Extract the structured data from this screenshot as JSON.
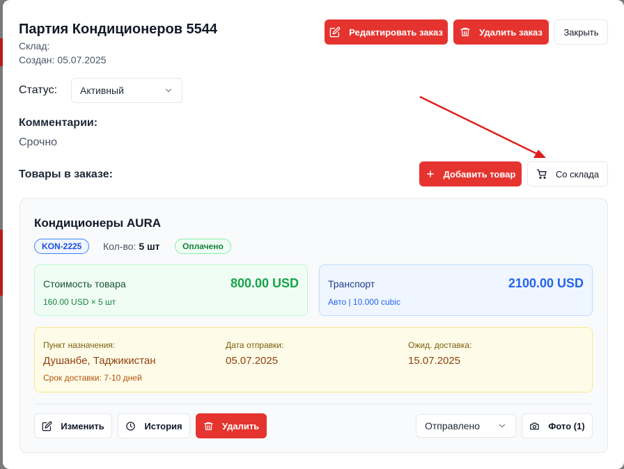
{
  "header": {
    "title": "Партия Кондиционеров 5544",
    "warehouse_line": "Склад:",
    "created_line": "Создан: 05.07.2025"
  },
  "actions": {
    "edit_label": "Редактировать заказ",
    "delete_label": "Удалить заказ",
    "close_label": "Закрыть"
  },
  "status": {
    "label": "Статус:",
    "value": "Активный"
  },
  "comments": {
    "label": "Комментарии:",
    "value": "Срочно"
  },
  "items_section": {
    "label": "Товары в заказе:",
    "add_label": "Добавить товар",
    "from_warehouse_label": "Со склада"
  },
  "item": {
    "name": "Кондиционеры AURA",
    "code": "KON-2225",
    "qty_label": "Кол-во:",
    "qty_value": "5 шт",
    "payment_badge": "Оплачено",
    "cost": {
      "label": "Стоимость товара",
      "amount": "800.00 USD",
      "detail": "160.00 USD × 5 шт"
    },
    "transport": {
      "label": "Транспорт",
      "amount": "2100.00 USD",
      "detail": "Авто | 10.000 cubic"
    },
    "delivery": {
      "destination_label": "Пункт назначения:",
      "destination_value": "Душанбе, Таджикистан",
      "ship_date_label": "Дата отправки:",
      "ship_date_value": "05.07.2025",
      "eta_label": "Ожид. доставка:",
      "eta_value": "15.07.2025",
      "term": "Срок доставки: 7-10 дней"
    },
    "footer": {
      "edit_label": "Изменить",
      "history_label": "История",
      "delete_label": "Удалить",
      "state_value": "Отправлено",
      "photo_label": "Фото (1)"
    }
  },
  "colors": {
    "primary_red": "#e5342f",
    "annotation_arrow": "#e11d1d",
    "cost_green": "#16a34a",
    "transport_blue": "#2563eb"
  },
  "icons": {
    "edit": "pencil-square-icon",
    "delete": "trash-icon",
    "add": "plus-icon",
    "cart": "cart-icon",
    "history": "clock-icon",
    "photo": "camera-icon",
    "dropdown": "chevron-down-icon"
  }
}
